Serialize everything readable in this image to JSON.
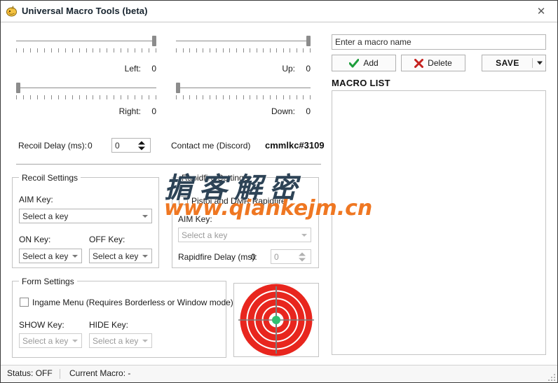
{
  "window": {
    "title": "Universal Macro Tools (beta)",
    "icon": "chick-app-icon",
    "close_label": "✕"
  },
  "sliders": [
    {
      "name": "left",
      "label": "Left:",
      "value": "0",
      "thumb_pct": 100
    },
    {
      "name": "up",
      "label": "Up:",
      "value": "0",
      "thumb_pct": 100
    },
    {
      "name": "right",
      "label": "Right:",
      "value": "0",
      "thumb_pct": 0
    },
    {
      "name": "down",
      "label": "Down:",
      "value": "0",
      "thumb_pct": 0
    }
  ],
  "recoil_delay": {
    "label": "Recoil Delay (ms):",
    "value": "0",
    "spinner_value": "0"
  },
  "contact": {
    "label": "Contact me (Discord)",
    "tag": "cmmlkc#3109"
  },
  "recoil_settings": {
    "title": "Recoil Settings",
    "aim_key_label": "AIM Key:",
    "aim_key_value": "Select a key",
    "on_key_label": "ON Key:",
    "on_key_value": "Select a key",
    "off_key_label": "OFF Key:",
    "off_key_value": "Select a key"
  },
  "rapidfire_settings": {
    "title": "Rapidfire Settings",
    "checkbox_label": "Pistol and DMR Rapidfire",
    "checkbox_checked": false,
    "aim_key_label": "AIM Key:",
    "aim_key_value": "Select a key",
    "delay_label": "Rapidfire Delay (ms):",
    "delay_value": "0",
    "delay_spinner_value": "0"
  },
  "form_settings": {
    "title": "Form Settings",
    "checkbox_label": "Ingame Menu (Requires Borderless or Window mode)",
    "checkbox_checked": false,
    "show_key_label": "SHOW Key:",
    "show_key_value": "Select a key",
    "hide_key_label": "HIDE Key:",
    "hide_key_value": "Select a key"
  },
  "macro_panel": {
    "name_input_value": "Enter a macro name",
    "name_input_placeholder": "Enter a macro name",
    "add_label": "Add",
    "delete_label": "Delete",
    "save_label": "SAVE",
    "list_heading": "MACRO LIST",
    "list_items": []
  },
  "status_bar": {
    "status": "Status: OFF",
    "current_macro": "Current Macro: -"
  },
  "target_image": {
    "name": "target-bullseye",
    "ring_color": "#E8261E",
    "center_color": "#2FBF71",
    "crosshair_color": "#7a7a7a",
    "ring_count": 5
  },
  "watermark": {
    "cn_text": "掮客解密",
    "url_text": "www.qiankejm.cn",
    "cn_color": "#2d4356",
    "url_color": "#ef7722"
  },
  "colors": {
    "accent_green": "#1E9E3C",
    "accent_red": "#C5221F",
    "border": "#c4c4c4"
  }
}
